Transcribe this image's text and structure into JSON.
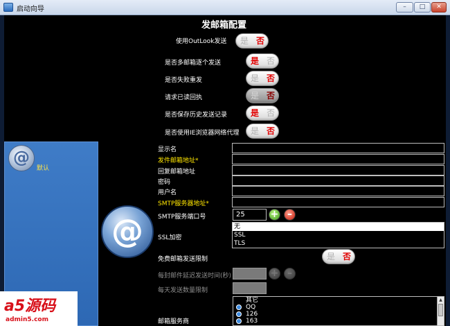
{
  "window": {
    "title": "启动向导",
    "buttons": {
      "minimize": "–",
      "restore": "□",
      "close": "✕"
    }
  },
  "sidebar": {
    "items": [
      {
        "label": "默认",
        "icon": "at-sign-icon"
      }
    ]
  },
  "main": {
    "heading": "发邮箱配置",
    "toggles": [
      {
        "label": "使用OutLook发送",
        "yes": "是",
        "no": "否",
        "value": "否"
      },
      {
        "label": "是否多邮箱逐个发送",
        "yes": "是",
        "no": "否",
        "value": "是"
      },
      {
        "label": "是否失败重发",
        "yes": "是",
        "no": "否",
        "value": "否"
      },
      {
        "label": "请求已读回执",
        "yes": "是",
        "no": "否",
        "value": "否",
        "disabled": true
      },
      {
        "label": "是否保存历史发送记录",
        "yes": "是",
        "no": "否",
        "value": "是"
      },
      {
        "label": "是否使用IE浏览器网络代理",
        "yes": "是",
        "no": "否",
        "value": "否"
      }
    ],
    "fields": {
      "display_name": {
        "label": "显示名",
        "value": ""
      },
      "sender_address": {
        "label": "发件邮箱地址*",
        "value": ""
      },
      "reply_address": {
        "label": "回复邮箱地址",
        "value": ""
      },
      "password": {
        "label": "密码",
        "value": ""
      },
      "username": {
        "label": "用户名",
        "value": ""
      },
      "smtp_server": {
        "label": "SMTP服务器地址*",
        "value": ""
      },
      "smtp_port": {
        "label": "SMTP服务端口号",
        "value": "25"
      }
    },
    "ssl": {
      "label": "SSL加密",
      "options": [
        "无",
        "SSL",
        "TLS"
      ],
      "selected": "无"
    },
    "free_limit": {
      "label": "免费邮箱发送限制",
      "yes": "是",
      "no": "否",
      "value": "否"
    },
    "delay": {
      "label": "每封邮件延迟发送时间(秒)",
      "value": ""
    },
    "daily_limit": {
      "label": "每天发送数量限制",
      "value": ""
    },
    "service_provider": {
      "label": "邮箱服务商",
      "options": [
        "其它",
        "QQ",
        "126",
        "163"
      ]
    }
  },
  "watermark": {
    "main": "a5源码",
    "sub": "admin5.com"
  },
  "colors": {
    "accent_red": "#e10000",
    "label_yellow": "#ffe600",
    "sidebar_blue": "#3a74c0"
  }
}
